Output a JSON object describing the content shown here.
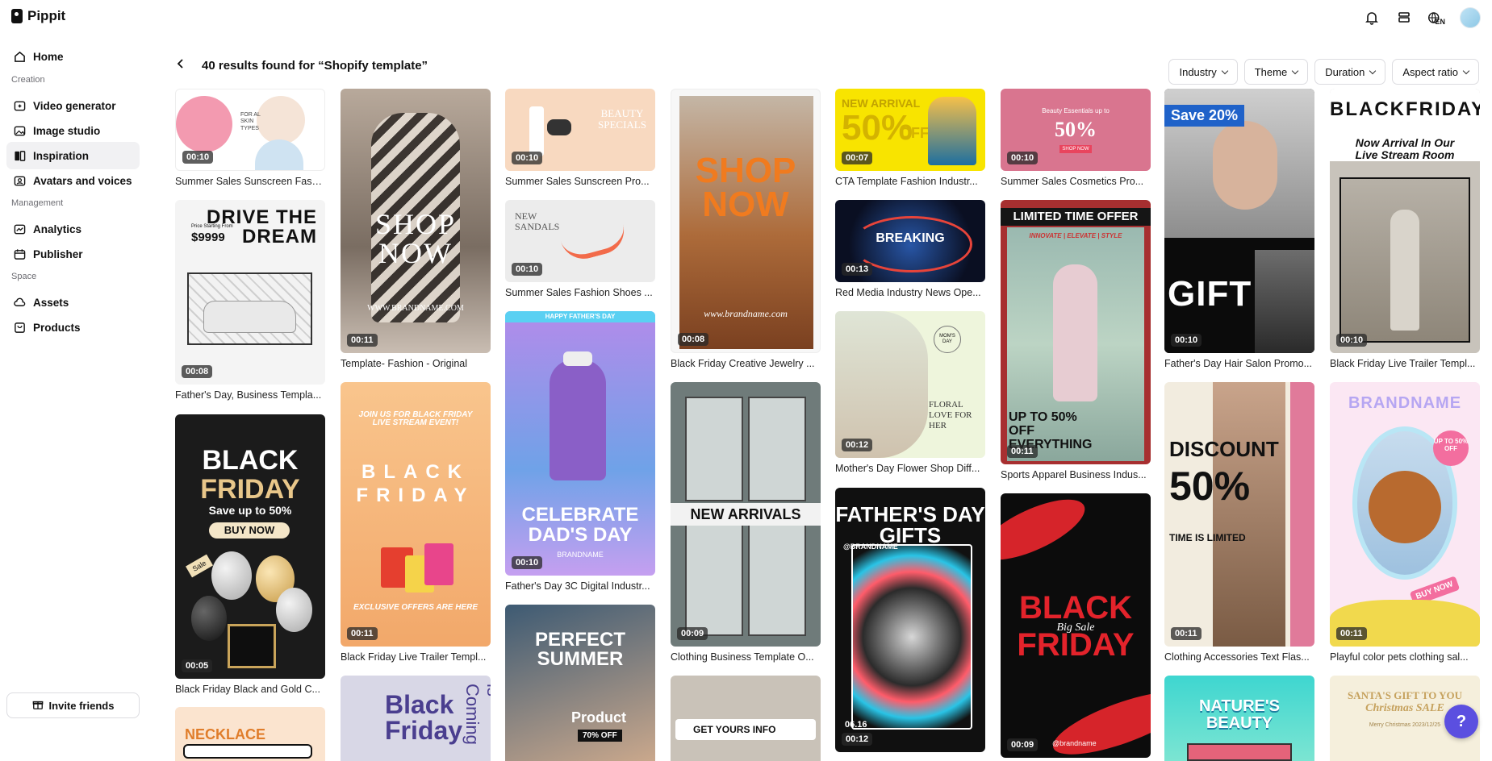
{
  "app": {
    "name": "Pippit"
  },
  "topbar": {
    "lang": "EN"
  },
  "sidebar": {
    "home": "Home",
    "sections": {
      "creation": "Creation",
      "management": "Management",
      "space": "Space"
    },
    "items": {
      "video_generator": "Video generator",
      "image_studio": "Image studio",
      "inspiration": "Inspiration",
      "avatars_voices": "Avatars and voices",
      "analytics": "Analytics",
      "publisher": "Publisher",
      "assets": "Assets",
      "products": "Products"
    },
    "invite": "Invite friends"
  },
  "header": {
    "title": "40 results found for “Shopify template”"
  },
  "filters": [
    "Industry",
    "Theme",
    "Duration",
    "Aspect ratio"
  ],
  "cards": [
    {
      "id": "c1",
      "duration": "00:10",
      "caption": "Summer Sales Sunscreen Fash...",
      "text": "FOR AL SKIN TYPES"
    },
    {
      "id": "c2",
      "duration": "00:08",
      "caption": "Father's Day, Business Templa...",
      "text": "DRIVE THE DREAM",
      "sub": "Price Starting From",
      "price": "$9999"
    },
    {
      "id": "c3",
      "duration": "00:05",
      "caption": "Black Friday Black and Gold C...",
      "text": "BLACK",
      "text2": "FRIDAY",
      "sub": "Save up to 50%",
      "btn": "BUY NOW",
      "tag": "Sale"
    },
    {
      "id": "c4",
      "duration": "",
      "caption": "",
      "text": "NECKLACE"
    },
    {
      "id": "c5",
      "duration": "00:11",
      "caption": "Template- Fashion - Original",
      "text": "SHOP",
      "text2": "NOW",
      "sub": "WWW.BRANDNAME.COM"
    },
    {
      "id": "c6",
      "duration": "00:11",
      "caption": "Black Friday Live Trailer Templ...",
      "text": "JOIN US FOR BLACK FRIDAY LIVE STREAM EVENT!",
      "text2": "BLACK FRIDAY",
      "sub": "EXCLUSIVE OFFERS ARE HERE"
    },
    {
      "id": "c7",
      "duration": "",
      "caption": "",
      "text": "Black",
      "text2": "Friday",
      "side": "is Coming"
    },
    {
      "id": "c8",
      "duration": "00:10",
      "caption": "Summer Sales Sunscreen Pro...",
      "text": "BEAUTY SPECIALS"
    },
    {
      "id": "c9",
      "duration": "00:10",
      "caption": "Summer Sales Fashion Shoes ...",
      "text": "NEW SANDALS"
    },
    {
      "id": "c10",
      "duration": "00:10",
      "caption": "Father's Day 3C Digital Industr...",
      "text": "CELEBRATE DAD'S DAY",
      "sub": "BRANDNAME",
      "banner": "HAPPY FATHER'S DAY"
    },
    {
      "id": "c11",
      "duration": "",
      "caption": "",
      "text": "PERFECT SUMMER",
      "sub": "Product",
      "badge": "70% OFF"
    },
    {
      "id": "c12",
      "duration": "00:08",
      "caption": "Black Friday Creative Jewelry ...",
      "text": "SHOP",
      "text2": "NOW",
      "sub": "www.brandname.com"
    },
    {
      "id": "c13",
      "duration": "00:09",
      "caption": "Clothing Business Template O...",
      "text": "NEW ARRIVALS"
    },
    {
      "id": "c14",
      "duration": "",
      "caption": "",
      "text": "GET YOURS INFO"
    },
    {
      "id": "c15",
      "duration": "00:07",
      "caption": "CTA Template Fashion Industr...",
      "text": "NEW ARRIVAL",
      "text2": "50%",
      "sub": "OFF"
    },
    {
      "id": "c16",
      "duration": "00:13",
      "caption": "Red Media Industry News Ope...",
      "text": "BREAKING"
    },
    {
      "id": "c17",
      "duration": "00:12",
      "caption": "Mother's Day Flower Shop Diff...",
      "text": "FLORAL LOVE FOR HER",
      "sub": "MOM'S DAY"
    },
    {
      "id": "c18",
      "duration": "00:12",
      "caption": "",
      "text": "FATHER'S DAY GIFTS",
      "sub": "@BRANDNAME",
      "date": "06.16"
    },
    {
      "id": "c19",
      "duration": "00:10",
      "caption": "Summer Sales Cosmetics Pro...",
      "text": "Beauty Essentials up to",
      "text2": "50%",
      "btn": "SHOP NOW"
    },
    {
      "id": "c20",
      "duration": "00:11",
      "caption": "Sports Apparel Business Indus...",
      "text": "LIMITED TIME OFFER",
      "sub": "INNOVATE | ELEVATE | STYLE",
      "text2": "UP TO 50% OFF EVERYTHING"
    },
    {
      "id": "c21",
      "duration": "00:09",
      "caption": "",
      "text": "BLACK",
      "text2": "FRIDAY",
      "sub": "Big Sale",
      "handle": "@brandname"
    },
    {
      "id": "c22",
      "duration": "00:10",
      "caption": "Father's Day Hair Salon Promo...",
      "text": "Save 20%",
      "text2": "GIFT"
    },
    {
      "id": "c23",
      "duration": "00:11",
      "caption": "Clothing Accessories Text Flas...",
      "text": "DISCOUNT",
      "text2": "50%",
      "sub": "TIME IS LIMITED"
    },
    {
      "id": "c24",
      "duration": "",
      "caption": "",
      "text": "NATURE'S BEAUTY"
    },
    {
      "id": "c25",
      "duration": "00:10",
      "caption": "Black Friday Live Trailer Templ...",
      "text": "BLACKFRIDAY",
      "sub": "Now Arrival In Our Live Stream Room"
    },
    {
      "id": "c26",
      "duration": "00:11",
      "caption": "Playful color pets clothing sal...",
      "text": "BRANDNAME",
      "sub": "UP TO 50% OFF",
      "btn": "BUY NOW"
    },
    {
      "id": "c27",
      "duration": "",
      "caption": "",
      "text": "SANTA'S GIFT TO YOU",
      "text2": "Christmas SALE",
      "sub": "Merry Christmas 2023/12/25"
    }
  ],
  "help": {
    "icon": "question-icon"
  }
}
